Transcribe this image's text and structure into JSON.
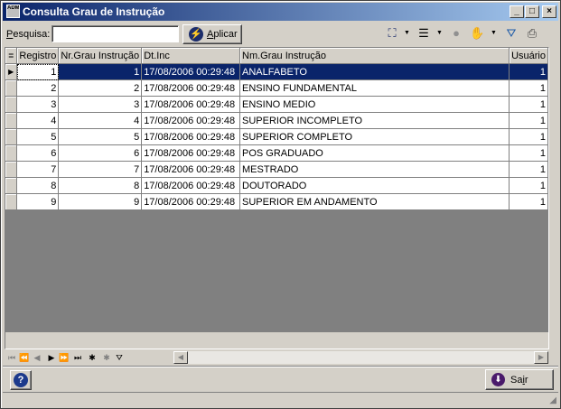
{
  "window": {
    "title": "Consulta Grau de Instrução",
    "icon_label": "ADM",
    "controls": [
      "_",
      "□",
      "×"
    ]
  },
  "toolbar": {
    "search_label_first": "P",
    "search_label_rest": "esquisa:",
    "search_value": "",
    "apply_label_first": "A",
    "apply_label_rest": "plicar",
    "icons": [
      "hierarchy-icon",
      "layout-icon",
      "record-icon",
      "hand-icon",
      "filter-icon",
      "print-icon"
    ]
  },
  "grid": {
    "columns": [
      "",
      "Registro",
      "Nr.Grau Instrução",
      "Dt.Inc",
      "Nm.Grau Instrução",
      "Usuário"
    ],
    "rows": [
      {
        "registro": "1",
        "nr": "1",
        "dt": "17/08/2006 00:29:48",
        "nm": "ANALFABETO",
        "usuario": "1"
      },
      {
        "registro": "2",
        "nr": "2",
        "dt": "17/08/2006 00:29:48",
        "nm": "ENSINO FUNDAMENTAL",
        "usuario": "1"
      },
      {
        "registro": "3",
        "nr": "3",
        "dt": "17/08/2006 00:29:48",
        "nm": "ENSINO MEDIO",
        "usuario": "1"
      },
      {
        "registro": "4",
        "nr": "4",
        "dt": "17/08/2006 00:29:48",
        "nm": "SUPERIOR INCOMPLETO",
        "usuario": "1"
      },
      {
        "registro": "5",
        "nr": "5",
        "dt": "17/08/2006 00:29:48",
        "nm": "SUPERIOR COMPLETO",
        "usuario": "1"
      },
      {
        "registro": "6",
        "nr": "6",
        "dt": "17/08/2006 00:29:48",
        "nm": "POS GRADUADO",
        "usuario": "1"
      },
      {
        "registro": "7",
        "nr": "7",
        "dt": "17/08/2006 00:29:48",
        "nm": "MESTRADO",
        "usuario": "1"
      },
      {
        "registro": "8",
        "nr": "8",
        "dt": "17/08/2006 00:29:48",
        "nm": "DOUTORADO",
        "usuario": "1"
      },
      {
        "registro": "9",
        "nr": "9",
        "dt": "17/08/2006 00:29:48",
        "nm": "SUPERIOR EM ANDAMENTO",
        "usuario": "1"
      }
    ],
    "selected_row": 0
  },
  "navigator": {
    "buttons": [
      "⏮",
      "⏪",
      "◀",
      "▶",
      "⏩",
      "⏭",
      "✱",
      "✱",
      "⛛"
    ]
  },
  "footer": {
    "help_label": "?",
    "exit_label_first": "Sa",
    "exit_label_u": "i",
    "exit_label_rest": "r"
  },
  "colors": {
    "selection": "#0a246a",
    "face": "#d4d0c8",
    "title_start": "#0a246a",
    "title_end": "#a6caf0"
  }
}
